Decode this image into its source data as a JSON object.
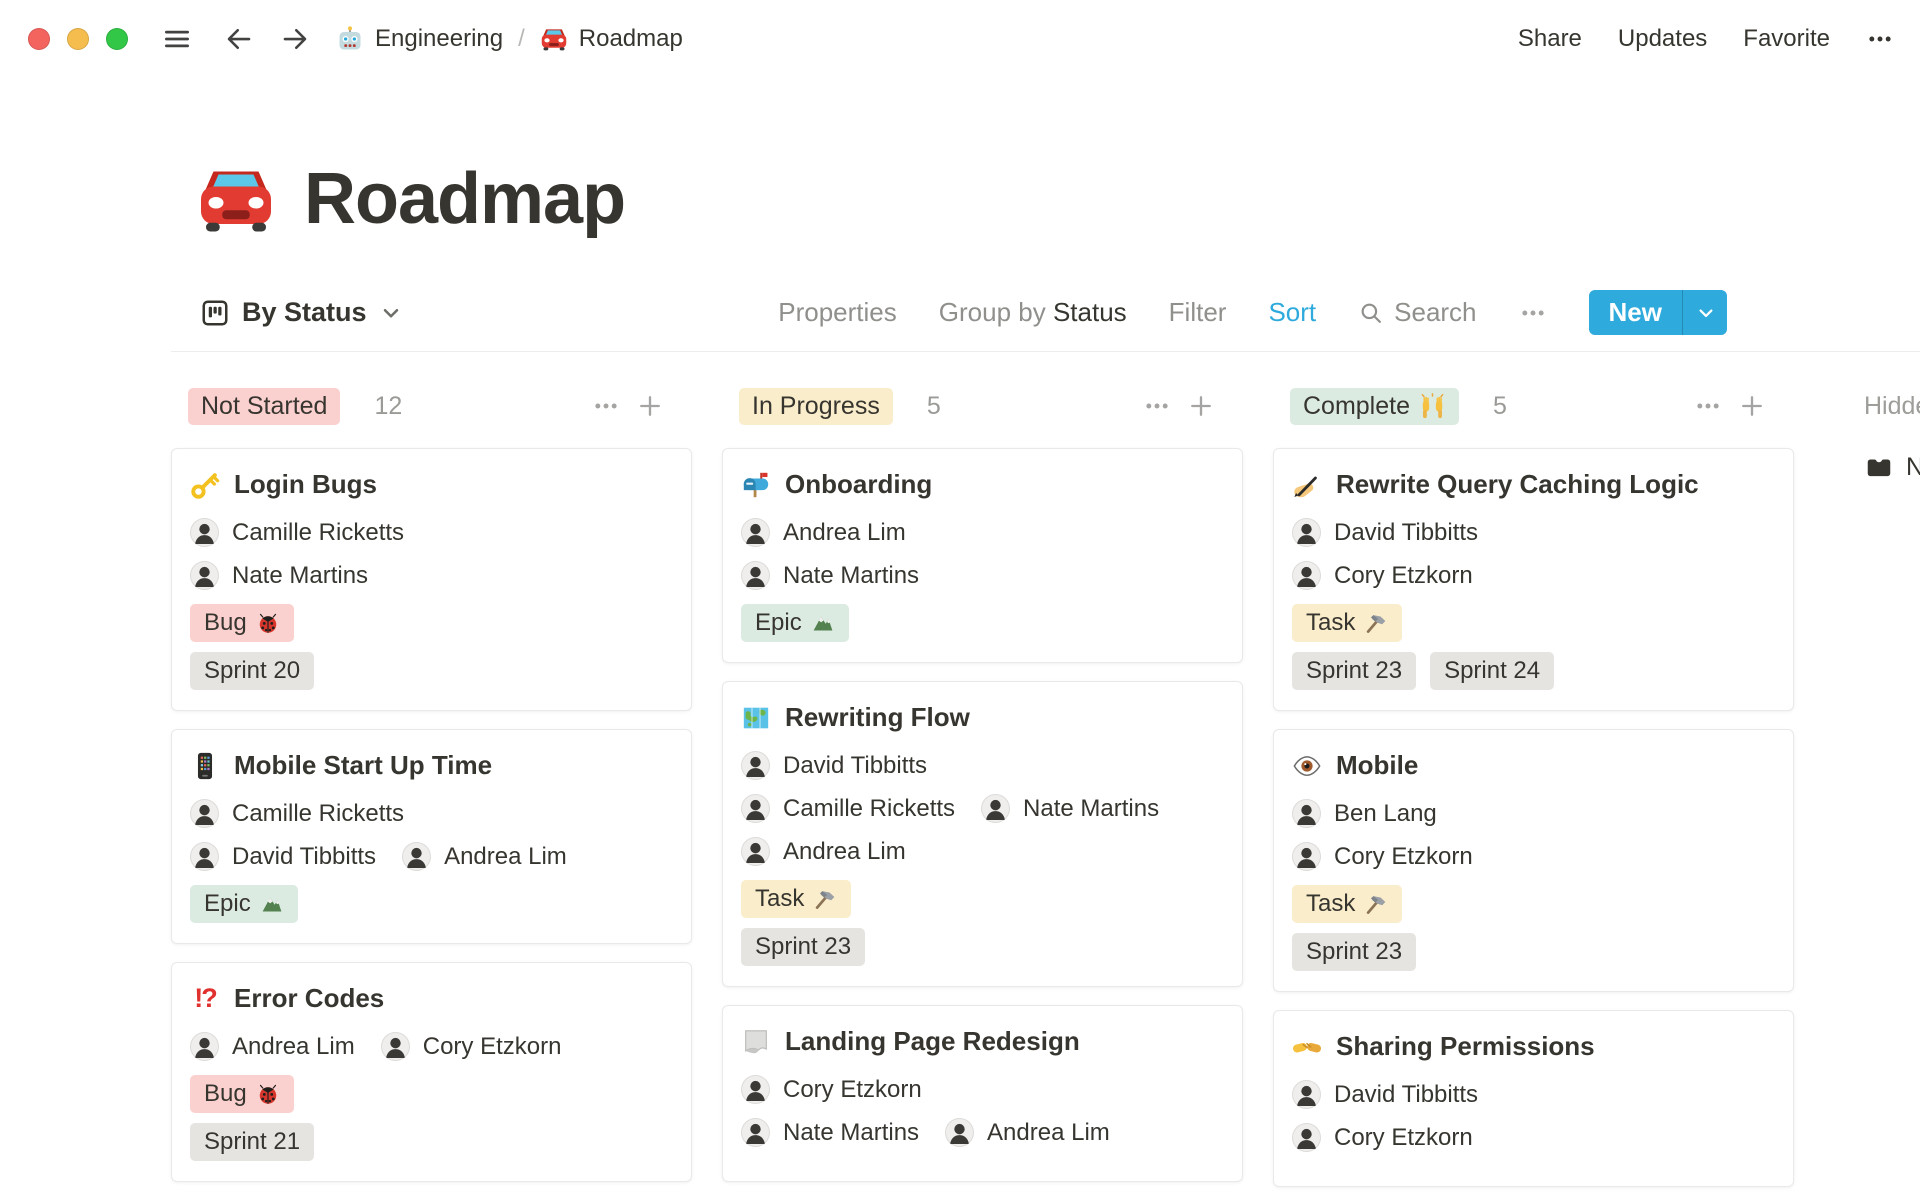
{
  "topbar": {
    "breadcrumb": {
      "workspace_icon": "robot-icon",
      "workspace": "Engineering",
      "separator": "/",
      "page_icon": "car-icon",
      "page": "Roadmap"
    },
    "actions": [
      {
        "label": "Share"
      },
      {
        "label": "Updates"
      },
      {
        "label": "Favorite"
      }
    ]
  },
  "page": {
    "icon": "car-icon",
    "title": "Roadmap"
  },
  "toolbar": {
    "view_icon": "board-icon",
    "view_label": "By Status",
    "properties_label": "Properties",
    "group_by_label": "Group by",
    "group_by_value": "Status",
    "filter_label": "Filter",
    "sort_label": "Sort",
    "search_label": "Search",
    "new_label": "New"
  },
  "colors": {
    "accent": "#2EAADC",
    "red": "#FBD1CF",
    "yellow": "#FAEDCC",
    "green": "#DCEBE2",
    "gray": "#E5E4E1",
    "text": "#37352F"
  },
  "board": {
    "columns": [
      {
        "label": "Not Started",
        "icon": null,
        "tone": "red",
        "count": "12",
        "cards": [
          {
            "icon": "key-icon",
            "title": "Login Bugs",
            "people": [
              [
                "Camille Ricketts"
              ],
              [
                "Nate Martins"
              ]
            ],
            "tag_rows": [
              [
                {
                  "label": "Bug",
                  "icon": "ladybug-icon",
                  "tone": "red"
                }
              ],
              [
                {
                  "label": "Sprint 20",
                  "icon": null,
                  "tone": "gray"
                }
              ]
            ]
          },
          {
            "icon": "mobile-phone-icon",
            "title": "Mobile Start Up Time",
            "people": [
              [
                "Camille Ricketts"
              ],
              [
                "David Tibbitts",
                "Andrea Lim"
              ]
            ],
            "tag_rows": [
              [
                {
                  "label": "Epic",
                  "icon": "mountain-icon",
                  "tone": "green"
                }
              ]
            ]
          },
          {
            "icon": "interrobang-icon",
            "title": "Error Codes",
            "people": [
              [
                "Andrea Lim",
                "Cory Etzkorn"
              ]
            ],
            "tag_rows": [
              [
                {
                  "label": "Bug",
                  "icon": "ladybug-icon",
                  "tone": "red"
                }
              ],
              [
                {
                  "label": "Sprint 21",
                  "icon": null,
                  "tone": "gray"
                }
              ]
            ]
          }
        ]
      },
      {
        "label": "In Progress",
        "icon": null,
        "tone": "yellow",
        "count": "5",
        "cards": [
          {
            "icon": "mailbox-icon",
            "title": "Onboarding",
            "people": [
              [
                "Andrea Lim"
              ],
              [
                "Nate Martins"
              ]
            ],
            "tag_rows": [
              [
                {
                  "label": "Epic",
                  "icon": "mountain-icon",
                  "tone": "green"
                }
              ]
            ]
          },
          {
            "icon": "world-map-icon",
            "title": "Rewriting Flow",
            "people": [
              [
                "David Tibbitts"
              ],
              [
                "Camille Ricketts",
                "Nate Martins"
              ],
              [
                "Andrea Lim"
              ]
            ],
            "tag_rows": [
              [
                {
                  "label": "Task",
                  "icon": "hammer-icon",
                  "tone": "yellow"
                }
              ],
              [
                {
                  "label": "Sprint 23",
                  "icon": null,
                  "tone": "gray"
                }
              ]
            ]
          },
          {
            "icon": "page-curl-icon",
            "title": "Landing Page Redesign",
            "people": [
              [
                "Cory Etzkorn"
              ],
              [
                "Nate Martins",
                "Andrea Lim"
              ]
            ],
            "tag_rows": []
          }
        ]
      },
      {
        "label": "Complete",
        "icon": "raised-hands-icon",
        "tone": "green",
        "count": "5",
        "cards": [
          {
            "icon": "writing-hand-icon",
            "title": "Rewrite Query Caching Logic",
            "people": [
              [
                "David Tibbitts"
              ],
              [
                "Cory Etzkorn"
              ]
            ],
            "tag_rows": [
              [
                {
                  "label": "Task",
                  "icon": "hammer-icon",
                  "tone": "yellow"
                }
              ],
              [
                {
                  "label": "Sprint 23",
                  "icon": null,
                  "tone": "gray"
                },
                {
                  "label": "Sprint 24",
                  "icon": null,
                  "tone": "gray"
                }
              ]
            ]
          },
          {
            "icon": "eye-icon",
            "title": "Mobile",
            "people": [
              [
                "Ben Lang"
              ],
              [
                "Cory Etzkorn"
              ]
            ],
            "tag_rows": [
              [
                {
                  "label": "Task",
                  "icon": "hammer-icon",
                  "tone": "yellow"
                }
              ],
              [
                {
                  "label": "Sprint 23",
                  "icon": null,
                  "tone": "gray"
                }
              ]
            ]
          },
          {
            "icon": "handshake-icon",
            "title": "Sharing Permissions",
            "people": [
              [
                "David Tibbitts"
              ],
              [
                "Cory Etzkorn"
              ]
            ],
            "tag_rows": []
          }
        ]
      }
    ],
    "hidden": {
      "label": "Hidden",
      "item_icon": "inbox-tray-icon",
      "item_label": "No"
    }
  }
}
